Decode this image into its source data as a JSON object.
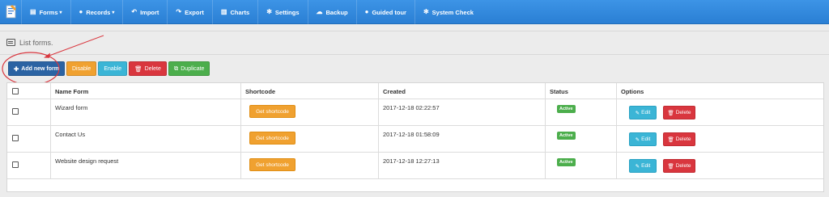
{
  "nav": {
    "items": [
      {
        "label": "Forms",
        "icon": "list-icon",
        "glyph": "▤",
        "caret": "▾"
      },
      {
        "label": "Records",
        "icon": "info-circle-icon",
        "glyph": "●",
        "caret": "▾"
      },
      {
        "label": "Import",
        "icon": "reply-icon",
        "glyph": "↶",
        "caret": ""
      },
      {
        "label": "Export",
        "icon": "share-icon",
        "glyph": "↷",
        "caret": ""
      },
      {
        "label": "Charts",
        "icon": "chart-icon",
        "glyph": "▥",
        "caret": ""
      },
      {
        "label": "Settings",
        "icon": "gear-icon",
        "glyph": "✻",
        "caret": ""
      },
      {
        "label": "Backup",
        "icon": "cloud-download-icon",
        "glyph": "☁",
        "caret": ""
      },
      {
        "label": "Guided tour",
        "icon": "question-circle-icon",
        "glyph": "●",
        "caret": ""
      },
      {
        "label": "System Check",
        "icon": "gear-icon",
        "glyph": "✻",
        "caret": ""
      }
    ]
  },
  "page": {
    "title": "List forms."
  },
  "toolbar": {
    "add_label": "Add new form",
    "disable_label": "Disable",
    "enable_label": "Enable",
    "delete_label": "Delete",
    "duplicate_label": "Duplicate"
  },
  "table": {
    "headers": {
      "name": "Name Form",
      "shortcode": "Shortcode",
      "created": "Created",
      "status": "Status",
      "options": "Options"
    },
    "rows": [
      {
        "name": "Wizard form",
        "shortcode_btn": "Get shortcode",
        "created": "2017-12-18 02:22:57",
        "status": "Active",
        "edit": "Edit",
        "delete": "Delete"
      },
      {
        "name": "Contact Us",
        "shortcode_btn": "Get shortcode",
        "created": "2017-12-18 01:58:09",
        "status": "Active",
        "edit": "Edit",
        "delete": "Delete"
      },
      {
        "name": "Website design request",
        "shortcode_btn": "Get shortcode",
        "created": "2017-12-18 12:27:13",
        "status": "Active",
        "edit": "Edit",
        "delete": "Delete"
      }
    ]
  },
  "colors": {
    "nav": "#2a7fd4",
    "primary": "#2b63a3",
    "warning": "#f0a130",
    "info": "#3bb5d6",
    "danger": "#d9363e",
    "success": "#4cae4c",
    "annotation": "#d9363e"
  }
}
